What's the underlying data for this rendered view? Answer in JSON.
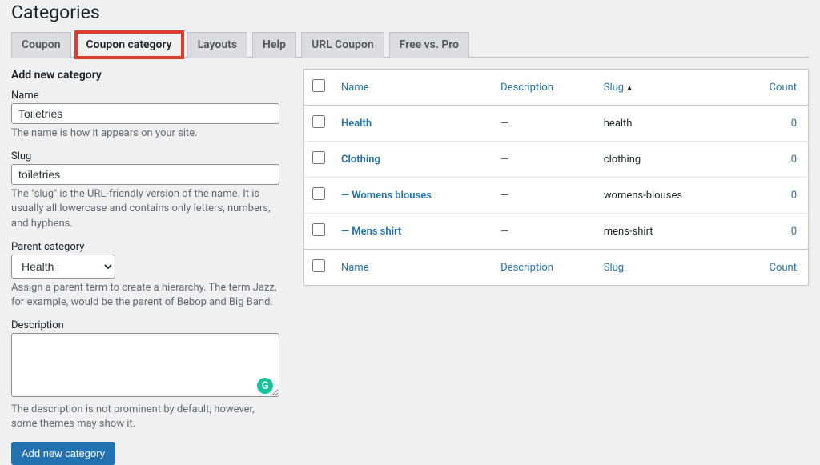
{
  "page_title": "Categories",
  "tabs": [
    {
      "label": "Coupon"
    },
    {
      "label": "Coupon category"
    },
    {
      "label": "Layouts"
    },
    {
      "label": "Help"
    },
    {
      "label": "URL Coupon"
    },
    {
      "label": "Free vs. Pro"
    }
  ],
  "form": {
    "section_title": "Add new category",
    "name_label": "Name",
    "name_value": "Toiletries",
    "name_desc": "The name is how it appears on your site.",
    "slug_label": "Slug",
    "slug_value": "toiletries",
    "slug_desc": "The \"slug\" is the URL-friendly version of the name. It is usually all lowercase and contains only letters, numbers, and hyphens.",
    "parent_label": "Parent category",
    "parent_value": "Health",
    "parent_desc": "Assign a parent term to create a hierarchy. The term Jazz, for example, would be the parent of Bebop and Big Band.",
    "desc_label": "Description",
    "desc_value": "",
    "desc_desc": "The description is not prominent by default; however, some themes may show it.",
    "submit_label": "Add new category"
  },
  "table": {
    "headers": {
      "name": "Name",
      "description": "Description",
      "slug": "Slug",
      "count": "Count"
    },
    "sort_indicator": "▲",
    "rows": [
      {
        "name": "Health",
        "description": "—",
        "slug": "health",
        "count": "0",
        "indent": ""
      },
      {
        "name": "Clothing",
        "description": "—",
        "slug": "clothing",
        "count": "0",
        "indent": ""
      },
      {
        "name": "Womens blouses",
        "description": "—",
        "slug": "womens-blouses",
        "count": "0",
        "indent": "— "
      },
      {
        "name": "Mens shirt",
        "description": "—",
        "slug": "mens-shirt",
        "count": "0",
        "indent": "— "
      }
    ]
  }
}
